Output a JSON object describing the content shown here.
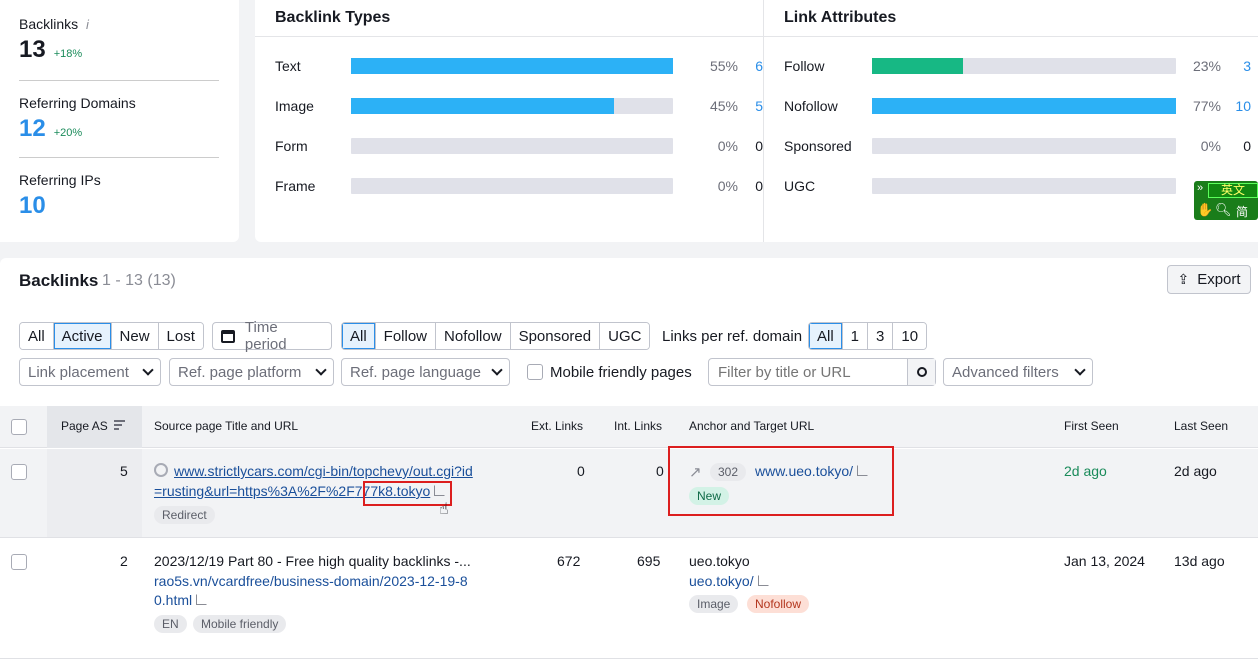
{
  "summary": {
    "backlinks": {
      "label": "Backlinks",
      "value": "13",
      "change": "+18%"
    },
    "ref_domains": {
      "label": "Referring Domains",
      "value": "12",
      "change": "+20%"
    },
    "ref_ips": {
      "label": "Referring IPs",
      "value": "10"
    }
  },
  "types": {
    "title": "Backlink Types",
    "rows": [
      {
        "name": "Text",
        "pct": "55%",
        "count": "6",
        "fraction": 1.0
      },
      {
        "name": "Image",
        "pct": "45%",
        "count": "5",
        "fraction": 0.817
      },
      {
        "name": "Form",
        "pct": "0%",
        "count": "0",
        "fraction": 0
      },
      {
        "name": "Frame",
        "pct": "0%",
        "count": "0",
        "fraction": 0
      }
    ]
  },
  "attributes": {
    "title": "Link Attributes",
    "rows": [
      {
        "name": "Follow",
        "pct": "23%",
        "count": "3",
        "fraction": 0.3,
        "color": "#17b884"
      },
      {
        "name": "Nofollow",
        "pct": "77%",
        "count": "10",
        "fraction": 1.0,
        "color": "#2cb1f6"
      },
      {
        "name": "Sponsored",
        "pct": "0%",
        "count": "0",
        "fraction": 0,
        "color": "#2cb1f6"
      },
      {
        "name": "UGC",
        "pct": "",
        "count": "",
        "fraction": 0,
        "color": "#2cb1f6"
      }
    ]
  },
  "translate_widget": {
    "top": "英文",
    "bottom": "简"
  },
  "backlinks": {
    "title": "Backlinks",
    "count": "1 - 13 (13)",
    "export": "Export",
    "status_filter": [
      "All",
      "Active",
      "New",
      "Lost"
    ],
    "time_period": "Time period",
    "type_filter": [
      "All",
      "Follow",
      "Nofollow",
      "Sponsored",
      "UGC"
    ],
    "links_per_label": "Links per ref. domain",
    "links_per": [
      "All",
      "1",
      "3",
      "10"
    ],
    "dropdowns": [
      "Link placement",
      "Ref. page platform",
      "Ref. page language"
    ],
    "mobile_label": "Mobile friendly pages",
    "search_placeholder": "Filter by title or URL",
    "advanced": "Advanced filters",
    "columns": [
      "Page AS",
      "Source page Title and URL",
      "Ext. Links",
      "Int. Links",
      "Anchor and Target URL",
      "First Seen",
      "Last Seen"
    ],
    "rows": [
      {
        "page_as": "5",
        "source_line1": "www.strictlycars.com/cgi-bin/topchevy/out.cgi?id",
        "source_line2a": "=rusting&url=https%3A%2F%2F",
        "source_line2b": "777k8.tokyo",
        "source_tag": "Redirect",
        "ext": "0",
        "int": "0",
        "redirect_code": "302",
        "target": "www.ueo.tokyo/",
        "anchor_tag": "New",
        "first_seen": "2d ago",
        "last_seen": "2d ago"
      },
      {
        "page_as": "2",
        "title": "2023/12/19 Part 80 - Free high quality backlinks -...",
        "source_line1": "rao5s.vn/vcardfree/business-domain/2023-12-19-8",
        "source_line2": "0.html",
        "tags": [
          "EN",
          "Mobile friendly"
        ],
        "ext": "672",
        "int": "695",
        "anchor": "ueo.tokyo",
        "target": "ueo.tokyo/",
        "anchor_tags": [
          "Image",
          "Nofollow"
        ],
        "first_seen": "Jan 13, 2024",
        "last_seen": "13d ago"
      }
    ]
  }
}
